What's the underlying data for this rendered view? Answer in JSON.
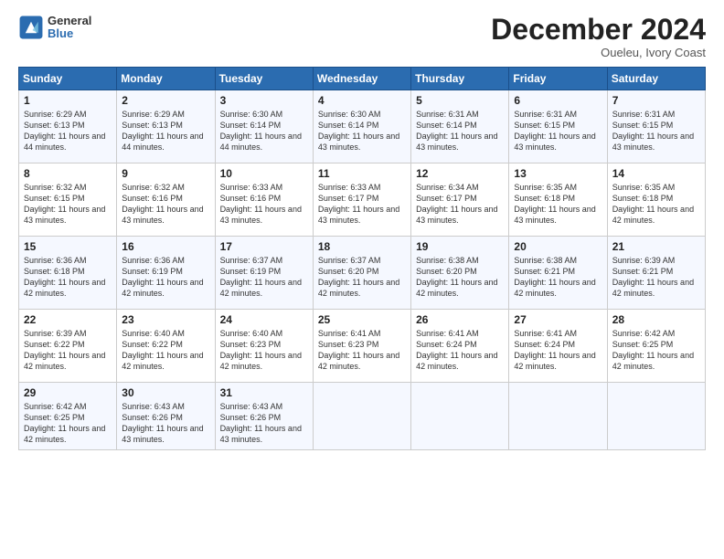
{
  "header": {
    "logo": {
      "general": "General",
      "blue": "Blue"
    },
    "title": "December 2024",
    "location": "Oueleu, Ivory Coast"
  },
  "weekdays": [
    "Sunday",
    "Monday",
    "Tuesday",
    "Wednesday",
    "Thursday",
    "Friday",
    "Saturday"
  ],
  "weeks": [
    [
      {
        "day": 1,
        "sunrise": "6:29 AM",
        "sunset": "6:13 PM",
        "daylight": "11 hours and 44 minutes."
      },
      {
        "day": 2,
        "sunrise": "6:29 AM",
        "sunset": "6:13 PM",
        "daylight": "11 hours and 44 minutes."
      },
      {
        "day": 3,
        "sunrise": "6:30 AM",
        "sunset": "6:14 PM",
        "daylight": "11 hours and 44 minutes."
      },
      {
        "day": 4,
        "sunrise": "6:30 AM",
        "sunset": "6:14 PM",
        "daylight": "11 hours and 43 minutes."
      },
      {
        "day": 5,
        "sunrise": "6:31 AM",
        "sunset": "6:14 PM",
        "daylight": "11 hours and 43 minutes."
      },
      {
        "day": 6,
        "sunrise": "6:31 AM",
        "sunset": "6:15 PM",
        "daylight": "11 hours and 43 minutes."
      },
      {
        "day": 7,
        "sunrise": "6:31 AM",
        "sunset": "6:15 PM",
        "daylight": "11 hours and 43 minutes."
      }
    ],
    [
      {
        "day": 8,
        "sunrise": "6:32 AM",
        "sunset": "6:15 PM",
        "daylight": "11 hours and 43 minutes."
      },
      {
        "day": 9,
        "sunrise": "6:32 AM",
        "sunset": "6:16 PM",
        "daylight": "11 hours and 43 minutes."
      },
      {
        "day": 10,
        "sunrise": "6:33 AM",
        "sunset": "6:16 PM",
        "daylight": "11 hours and 43 minutes."
      },
      {
        "day": 11,
        "sunrise": "6:33 AM",
        "sunset": "6:17 PM",
        "daylight": "11 hours and 43 minutes."
      },
      {
        "day": 12,
        "sunrise": "6:34 AM",
        "sunset": "6:17 PM",
        "daylight": "11 hours and 43 minutes."
      },
      {
        "day": 13,
        "sunrise": "6:35 AM",
        "sunset": "6:18 PM",
        "daylight": "11 hours and 43 minutes."
      },
      {
        "day": 14,
        "sunrise": "6:35 AM",
        "sunset": "6:18 PM",
        "daylight": "11 hours and 42 minutes."
      }
    ],
    [
      {
        "day": 15,
        "sunrise": "6:36 AM",
        "sunset": "6:18 PM",
        "daylight": "11 hours and 42 minutes."
      },
      {
        "day": 16,
        "sunrise": "6:36 AM",
        "sunset": "6:19 PM",
        "daylight": "11 hours and 42 minutes."
      },
      {
        "day": 17,
        "sunrise": "6:37 AM",
        "sunset": "6:19 PM",
        "daylight": "11 hours and 42 minutes."
      },
      {
        "day": 18,
        "sunrise": "6:37 AM",
        "sunset": "6:20 PM",
        "daylight": "11 hours and 42 minutes."
      },
      {
        "day": 19,
        "sunrise": "6:38 AM",
        "sunset": "6:20 PM",
        "daylight": "11 hours and 42 minutes."
      },
      {
        "day": 20,
        "sunrise": "6:38 AM",
        "sunset": "6:21 PM",
        "daylight": "11 hours and 42 minutes."
      },
      {
        "day": 21,
        "sunrise": "6:39 AM",
        "sunset": "6:21 PM",
        "daylight": "11 hours and 42 minutes."
      }
    ],
    [
      {
        "day": 22,
        "sunrise": "6:39 AM",
        "sunset": "6:22 PM",
        "daylight": "11 hours and 42 minutes."
      },
      {
        "day": 23,
        "sunrise": "6:40 AM",
        "sunset": "6:22 PM",
        "daylight": "11 hours and 42 minutes."
      },
      {
        "day": 24,
        "sunrise": "6:40 AM",
        "sunset": "6:23 PM",
        "daylight": "11 hours and 42 minutes."
      },
      {
        "day": 25,
        "sunrise": "6:41 AM",
        "sunset": "6:23 PM",
        "daylight": "11 hours and 42 minutes."
      },
      {
        "day": 26,
        "sunrise": "6:41 AM",
        "sunset": "6:24 PM",
        "daylight": "11 hours and 42 minutes."
      },
      {
        "day": 27,
        "sunrise": "6:41 AM",
        "sunset": "6:24 PM",
        "daylight": "11 hours and 42 minutes."
      },
      {
        "day": 28,
        "sunrise": "6:42 AM",
        "sunset": "6:25 PM",
        "daylight": "11 hours and 42 minutes."
      }
    ],
    [
      {
        "day": 29,
        "sunrise": "6:42 AM",
        "sunset": "6:25 PM",
        "daylight": "11 hours and 42 minutes."
      },
      {
        "day": 30,
        "sunrise": "6:43 AM",
        "sunset": "6:26 PM",
        "daylight": "11 hours and 43 minutes."
      },
      {
        "day": 31,
        "sunrise": "6:43 AM",
        "sunset": "6:26 PM",
        "daylight": "11 hours and 43 minutes."
      },
      null,
      null,
      null,
      null
    ]
  ]
}
